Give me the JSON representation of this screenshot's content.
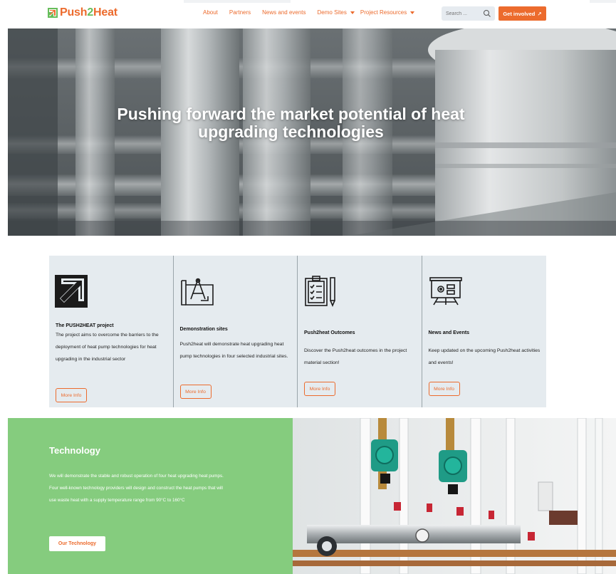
{
  "header": {
    "logo_prefix": "Push",
    "logo_num": "2",
    "logo_suffix": "Heat",
    "nav": [
      {
        "label": "About"
      },
      {
        "label": "Partners"
      },
      {
        "label": "News and events"
      },
      {
        "label": "Demo Sites"
      },
      {
        "label": "Project Resources"
      }
    ],
    "search_placeholder": "Search ...",
    "cta_label": "Get involved",
    "cta_arrow": "↗"
  },
  "hero": {
    "title_line1": "Pushing forward the market potential of heat",
    "title_line2": "upgrading technologies"
  },
  "cards": [
    {
      "title": "The PUSH2HEAT project",
      "text": "The project aims to overcome the barriers to the deployment of heat pump technologies for heat upgrading in the industrial sector",
      "button": "More Info",
      "icon": "arrow-logo-icon"
    },
    {
      "title": "Demonstration sites",
      "text": "Push2heat will demonstrate heat upgrading heat pump technologies in four selected industrial sites.",
      "button": "More Info",
      "icon": "blueprint-compass-icon"
    },
    {
      "title": "Push2heat Outcomes",
      "text": "Discover the Push2heat outcomes in the project material section!",
      "button": "More Info",
      "icon": "clipboard-checklist-icon"
    },
    {
      "title": "News and Events",
      "text": "Keep updated on the upcoming Push2heat activities and events!",
      "button": "More Info",
      "icon": "presentation-board-icon"
    }
  ],
  "technology": {
    "title": "Technology",
    "text": "We will demonstrate the stable and robust operation of four heat upgrading heat pumps. Four well-known technology providers will design and construct the heat pumps that will use waste heat with a supply temperature range from 90°C to 160°C",
    "button": "Our Technology"
  },
  "colors": {
    "accent": "#ec6b2d",
    "green": "#85cc7e",
    "card_bg": "#e5ebef"
  }
}
